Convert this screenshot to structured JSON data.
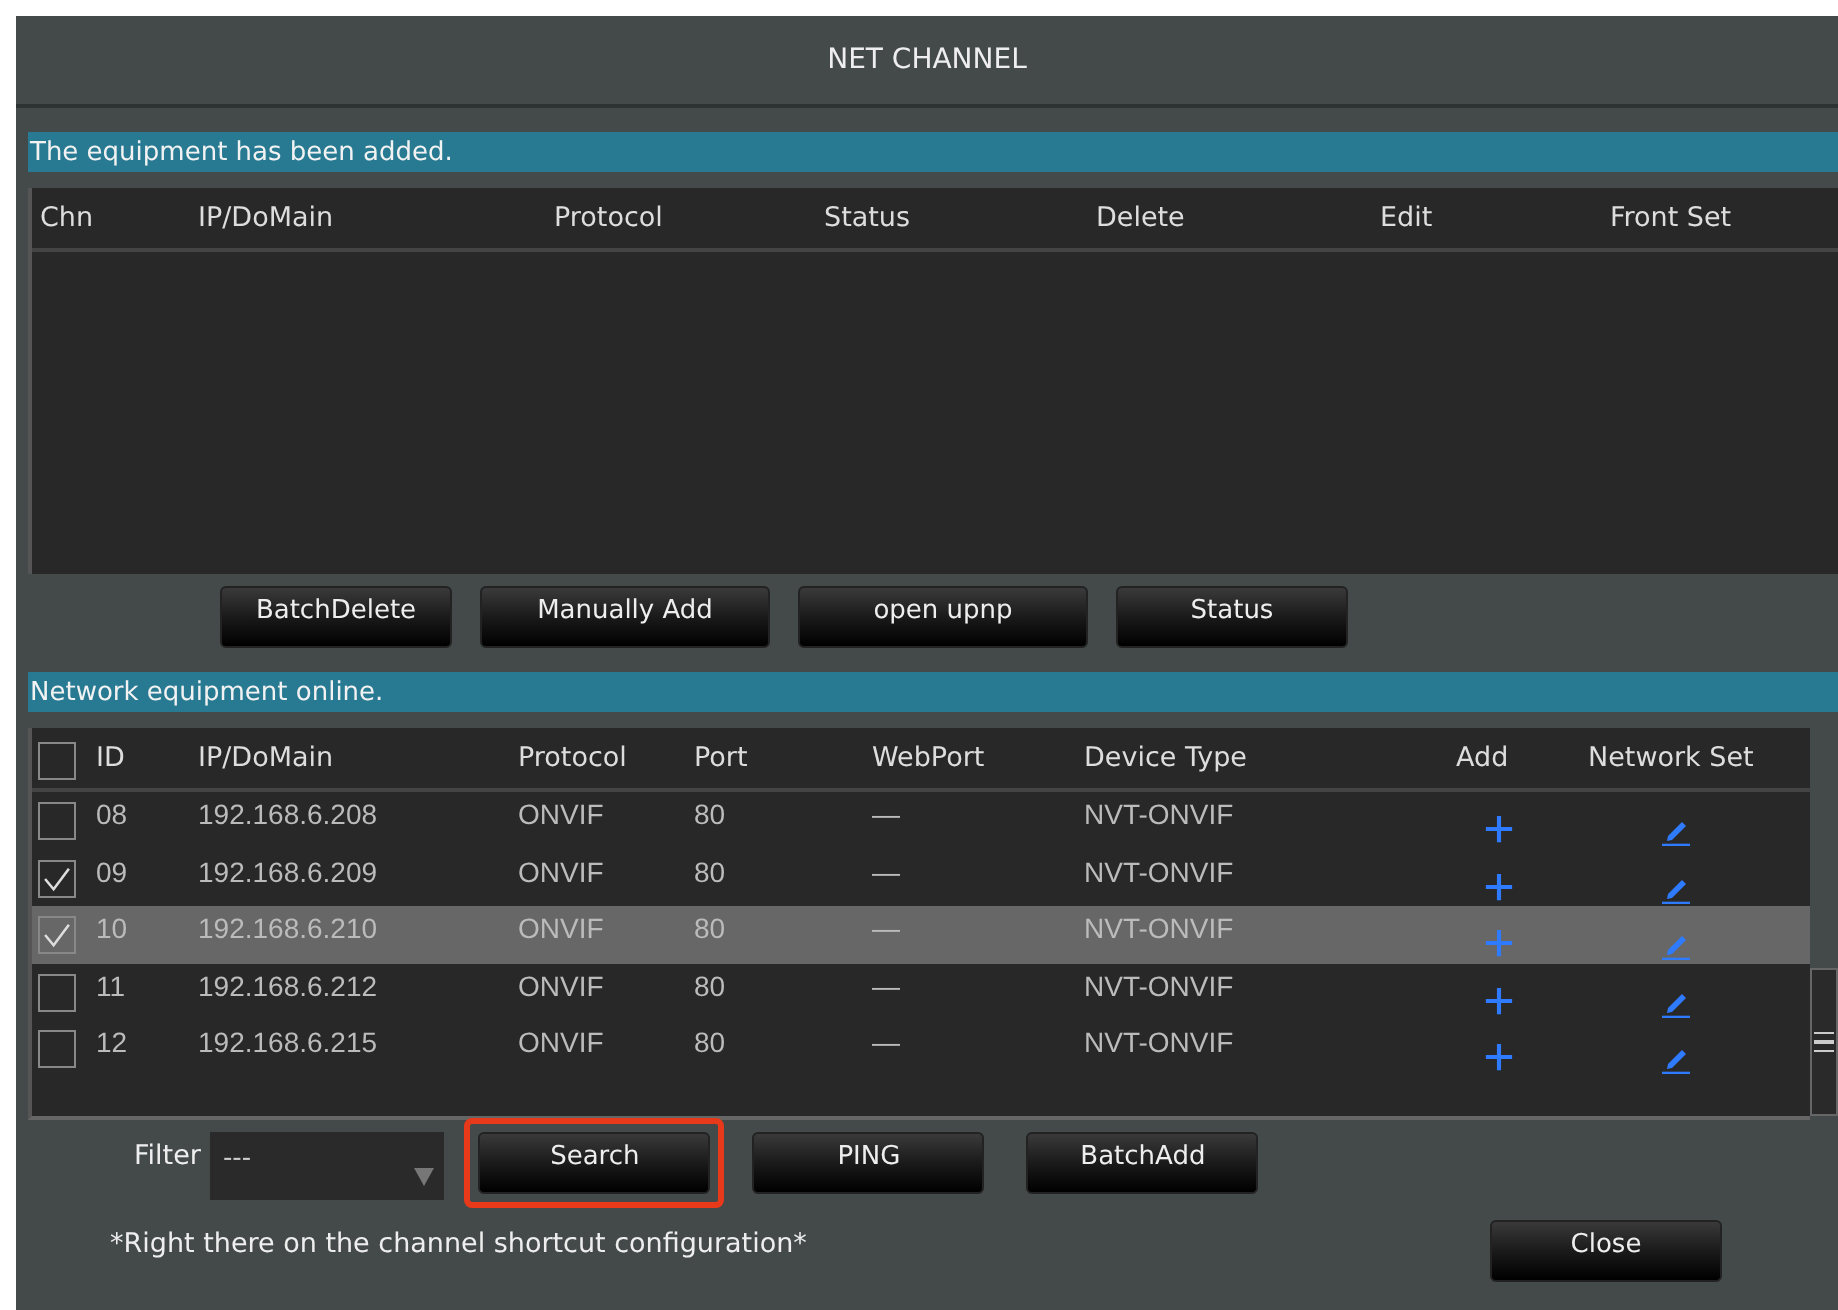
{
  "window": {
    "title": "NET CHANNEL"
  },
  "added": {
    "caption": "The equipment has been added.",
    "columns": [
      "Chn",
      "IP/DoMain",
      "Protocol",
      "Status",
      "Delete",
      "Edit",
      "Front Set"
    ]
  },
  "added_buttons": [
    "BatchDelete",
    "Manually Add",
    "open upnp",
    "Status"
  ],
  "online": {
    "caption": "Network equipment online.",
    "select_all": {
      "checked": false
    },
    "columns": [
      "ID",
      "IP/DoMain",
      "Protocol",
      "Port",
      "WebPort",
      "Device Type",
      "Add",
      "Network Set"
    ],
    "rows": [
      {
        "id": "08",
        "ip": "192.168.6.208",
        "protocol": "ONVIF",
        "port": "80",
        "webport": "—",
        "device_type": "NVT-ONVIF",
        "checked": false,
        "selected": false
      },
      {
        "id": "09",
        "ip": "192.168.6.209",
        "protocol": "ONVIF",
        "port": "80",
        "webport": "—",
        "device_type": "NVT-ONVIF",
        "checked": true,
        "selected": false
      },
      {
        "id": "10",
        "ip": "192.168.6.210",
        "protocol": "ONVIF",
        "port": "80",
        "webport": "—",
        "device_type": "NVT-ONVIF",
        "checked": true,
        "selected": true
      },
      {
        "id": "11",
        "ip": "192.168.6.212",
        "protocol": "ONVIF",
        "port": "80",
        "webport": "—",
        "device_type": "NVT-ONVIF",
        "checked": false,
        "selected": false
      },
      {
        "id": "12",
        "ip": "192.168.6.215",
        "protocol": "ONVIF",
        "port": "80",
        "webport": "—",
        "device_type": "NVT-ONVIF",
        "checked": false,
        "selected": false
      }
    ]
  },
  "filter": {
    "label": "Filter",
    "value": "---"
  },
  "online_buttons": [
    {
      "label": "Search",
      "highlighted": true
    },
    {
      "label": "PING",
      "highlighted": false
    },
    {
      "label": "BatchAdd",
      "highlighted": false
    }
  ],
  "note": "*Right there on the channel shortcut configuration*",
  "close_button": "Close"
}
